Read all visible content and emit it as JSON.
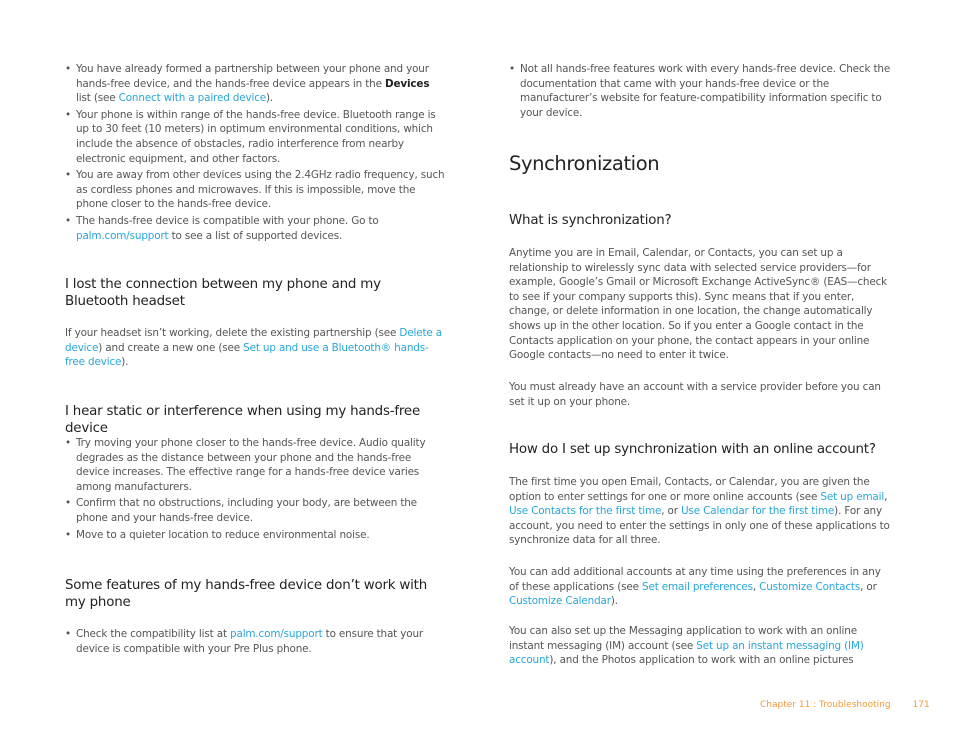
{
  "left_column": {
    "top_bullets": [
      {
        "parts": [
          {
            "t": "You have already formed a partnership between your phone and your hands-free device, and the hands-free device appears in the "
          },
          {
            "t": "Devices",
            "style": "bold"
          },
          {
            "t": " list (see "
          },
          {
            "t": "Connect with a paired device",
            "style": "link"
          },
          {
            "t": ")."
          }
        ]
      },
      {
        "parts": [
          {
            "t": "Your phone is within range of the hands-free device. Bluetooth range is up to 30 feet (10 meters) in optimum environmental conditions, which include the absence of obstacles, radio interference from nearby electronic equipment, and other factors."
          }
        ]
      },
      {
        "parts": [
          {
            "t": "You are away from other devices using the 2.4GHz radio frequency, such as cordless phones and microwaves. If this is impossible, move the phone closer to the hands-free device."
          }
        ]
      },
      {
        "parts": [
          {
            "t": "The hands-free device is compatible with your phone. Go to "
          },
          {
            "t": "palm.com/support",
            "style": "link"
          },
          {
            "t": " to see a list of supported devices."
          }
        ]
      }
    ],
    "lost_connection": {
      "heading": "I lost the connection between my phone and my Bluetooth headset",
      "paragraph": [
        {
          "t": "If your headset isn’t working, delete the existing partnership (see "
        },
        {
          "t": "Delete a device",
          "style": "link"
        },
        {
          "t": ") and create a new one (see "
        },
        {
          "t": "Set up and use a Bluetooth® hands-free device",
          "style": "link"
        },
        {
          "t": ")."
        }
      ]
    },
    "static": {
      "heading": "I hear static or interference when using my hands-free device",
      "bullets": [
        {
          "parts": [
            {
              "t": "Try moving your phone closer to the hands-free device. Audio quality degrades as the distance between your phone and the hands-free device increases. The effective range for a hands-free device varies among manufacturers."
            }
          ]
        },
        {
          "parts": [
            {
              "t": "Confirm that no obstructions, including your body, are between the phone and your hands-free device."
            }
          ]
        },
        {
          "parts": [
            {
              "t": "Move to a quieter location to reduce environmental noise."
            }
          ]
        }
      ]
    },
    "features": {
      "heading": "Some features of my hands-free device don’t work with my phone",
      "bullets": [
        {
          "parts": [
            {
              "t": "Check the compatibility list at "
            },
            {
              "t": "palm.com/support",
              "style": "link"
            },
            {
              "t": " to ensure that your device is compatible with your Pre Plus phone."
            }
          ]
        }
      ]
    }
  },
  "right_column": {
    "top_bullets": [
      {
        "parts": [
          {
            "t": "Not all hands-free features work with every hands-free device. Check the documentation that came with your hands-free device or the manufacturer’s website for feature-compatibility information specific to your device."
          }
        ]
      }
    ],
    "section_title": "Synchronization",
    "what_is": {
      "heading": "What is synchronization?",
      "paragraphs": [
        [
          {
            "t": "Anytime you are in Email, Calendar, or Contacts, you can set up a relationship to wirelessly sync data with selected service providers—for example, Google’s Gmail or Microsoft Exchange ActiveSync® (EAS—check to see if your company supports this). Sync means that if you enter, change, or delete information in one location, the change automatically shows up in the other location. So if you enter a Google contact in the Contacts application on your phone, the contact appears in your online Google contacts—no need to enter it twice."
          }
        ],
        [
          {
            "t": "You must already have an account with a service provider before you can set it up on your phone."
          }
        ]
      ]
    },
    "how_to": {
      "heading": "How do I set up synchronization with an online account?",
      "paragraphs": [
        [
          {
            "t": "The first time you open Email, Contacts, or Calendar, you are given the option to enter settings for one or more online accounts (see "
          },
          {
            "t": "Set up email",
            "style": "link"
          },
          {
            "t": ", "
          },
          {
            "t": "Use Contacts for the first time",
            "style": "link"
          },
          {
            "t": ", or "
          },
          {
            "t": "Use Calendar for the first time",
            "style": "link"
          },
          {
            "t": "). For any account, you need to enter the settings in only one of these applications to synchronize data for all three."
          }
        ],
        [
          {
            "t": "You can add additional accounts at any time using the preferences in any of these applications (see "
          },
          {
            "t": "Set email preferences",
            "style": "link"
          },
          {
            "t": ", "
          },
          {
            "t": "Customize Contacts",
            "style": "link"
          },
          {
            "t": ", or "
          },
          {
            "t": "Customize Calendar",
            "style": "link"
          },
          {
            "t": ")."
          }
        ],
        [
          {
            "t": "You can also set up the Messaging application to work with an online instant messaging (IM) account (see "
          },
          {
            "t": "Set up an instant messaging (IM) account",
            "style": "link"
          },
          {
            "t": "), and the Photos application to work with an online pictures"
          }
        ]
      ]
    }
  },
  "footer": {
    "chapter": "Chapter 11  :  Troubleshooting",
    "page_number": "171"
  },
  "colors": {
    "link": "#27a6d9",
    "body_text": "#555555",
    "heading": "#222222",
    "footer": "#f39a3c"
  }
}
